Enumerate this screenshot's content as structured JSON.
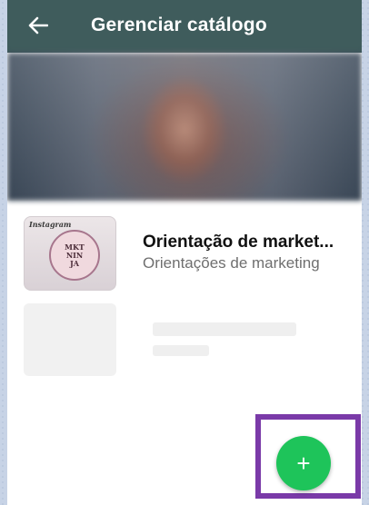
{
  "appbar": {
    "title": "Gerenciar catálogo",
    "back_icon": "arrow-left-icon"
  },
  "catalog": {
    "items": [
      {
        "title": "Orientação de market...",
        "subtitle": "Orientações de marketing",
        "thumbnail": {
          "brand": "Instagram",
          "circle_lines": [
            "MKT",
            "NIN",
            "JA"
          ]
        }
      }
    ]
  },
  "fab": {
    "icon": "plus-icon",
    "label": "+",
    "color": "#1ec45a"
  },
  "colors": {
    "appbar": "#3f5c5c",
    "highlight": "#7a3aa8"
  }
}
